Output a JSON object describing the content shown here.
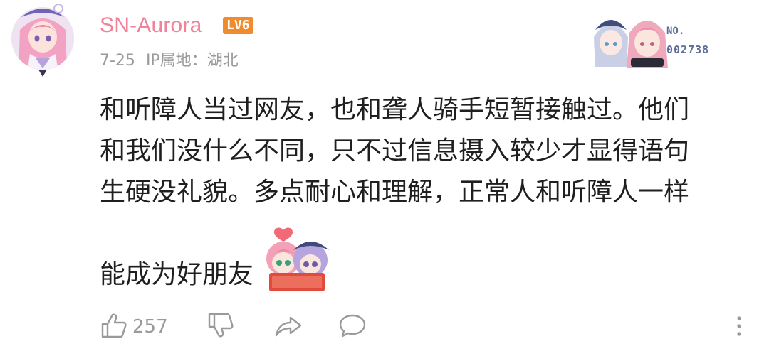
{
  "user": {
    "name": "SN-Aurora",
    "level_badge": "LV6",
    "date": "7-25",
    "ip_location": "IP属地：湖北"
  },
  "fan_badge": {
    "label": "NO.",
    "number": "002738"
  },
  "comment": {
    "lines": [
      "和听障人当过网友，也和聋人骑手短暂接触过。他们",
      "和我们没什么不同，只不过信息摄入较少才显得语句",
      "生硬没礼貌。多点耐心和理解，正常人和听障人一样",
      "能成为好朋友"
    ]
  },
  "actions": {
    "like_count": "257"
  },
  "colors": {
    "username": "#f0839a",
    "level_badge": "#f08c2e",
    "meta_text": "#9a9a9a",
    "icon": "#9a9a9a"
  },
  "icons": [
    "thumbs-up-icon",
    "thumbs-down-icon",
    "share-icon",
    "comment-icon",
    "more-vertical-icon"
  ]
}
